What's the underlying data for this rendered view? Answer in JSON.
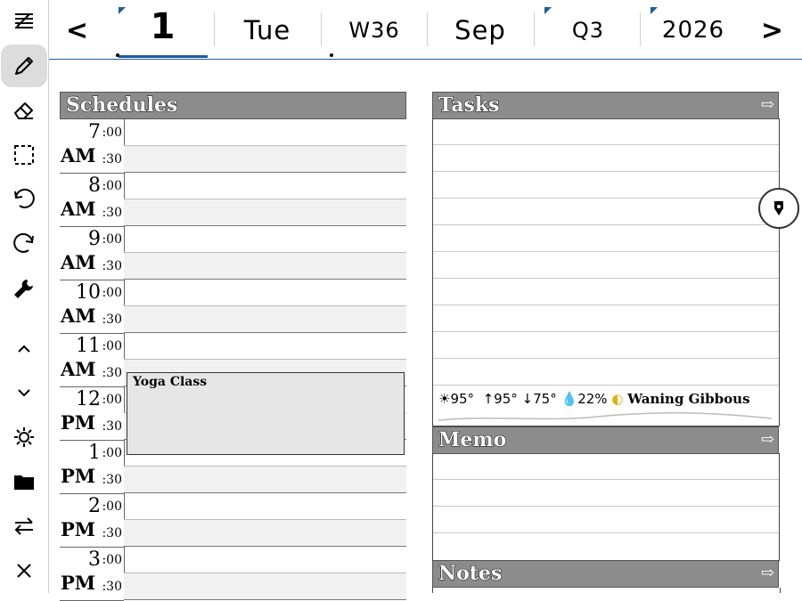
{
  "header": {
    "prev": "<",
    "day": "1",
    "weekday": "Tue",
    "week": "W36",
    "month": "Sep",
    "quarter": "Q3",
    "year": "2026",
    "next": ">"
  },
  "toolbar": {
    "tools": [
      "menu-icon",
      "pen-icon",
      "eraser-icon",
      "lasso-select-icon",
      "undo-icon",
      "redo-icon",
      "wrench-icon",
      "chevron-up-icon",
      "chevron-down-icon",
      "brightness-icon",
      "folder-icon",
      "swap-icon",
      "close-icon"
    ]
  },
  "schedules": {
    "title": "Schedules",
    "minute_top": ":00",
    "minute_bottom": ":30",
    "hours": [
      {
        "hour": "7",
        "ampm": "AM"
      },
      {
        "hour": "8",
        "ampm": "AM"
      },
      {
        "hour": "9",
        "ampm": "AM"
      },
      {
        "hour": "10",
        "ampm": "AM"
      },
      {
        "hour": "11",
        "ampm": "AM"
      },
      {
        "hour": "12",
        "ampm": "PM"
      },
      {
        "hour": "1",
        "ampm": "PM"
      },
      {
        "hour": "2",
        "ampm": "PM"
      },
      {
        "hour": "3",
        "ampm": "PM"
      }
    ],
    "event": {
      "title": "Yoga Class"
    }
  },
  "tasks": {
    "title": "Tasks",
    "arrow": "⇨"
  },
  "weather": {
    "now": "95°",
    "high": "95°",
    "low": "75°",
    "precip": "22%",
    "moon": "Waning Gibbous"
  },
  "memo": {
    "title": "Memo",
    "arrow": "⇨"
  },
  "notes": {
    "title": "Notes",
    "arrow": "⇨"
  },
  "colors": {
    "accent": "#1e5b9e",
    "title_bar": "#8c8c8c",
    "event_fill": "#e6e6e6"
  }
}
